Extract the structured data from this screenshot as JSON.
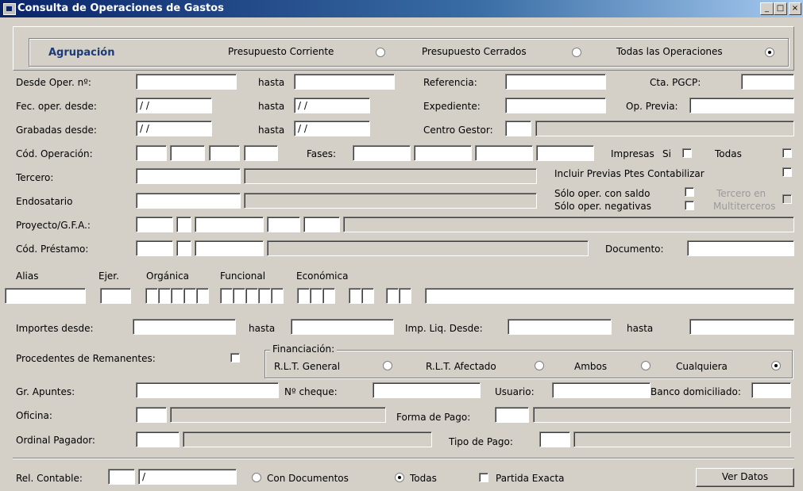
{
  "window": {
    "title": "Consulta de Operaciones de Gastos",
    "min_label": "_",
    "max_label": "□",
    "close_label": "×"
  },
  "agrupacion": {
    "label": "Agrupación",
    "options": [
      "Presupuesto Corriente",
      "Presupuesto Cerrados",
      "Todas las Operaciones"
    ],
    "selected": "Todas las Operaciones"
  },
  "labels": {
    "desde_oper": "Desde Oper. nº:",
    "hasta": "hasta",
    "referencia": "Referencia:",
    "cta_pgcp": "Cta. PGCP:",
    "fec_oper": "Fec. oper. desde:",
    "expediente": "Expediente:",
    "op_previa": "Op. Previa:",
    "grabadas": "Grabadas desde:",
    "centro_gestor": "Centro Gestor:",
    "cod_operacion": "Cód. Operación:",
    "fases": "Fases:",
    "impresas": "Impresas",
    "si": "Si",
    "todas": "Todas",
    "tercero": "Tercero:",
    "incluir_previas": "Incluir Previas Ptes Contabilizar",
    "endosatario": "Endosatario",
    "solo_saldo": "Sólo oper. con saldo",
    "solo_negativas": "Sólo oper. negativas",
    "tercero_en": "Tercero en",
    "multiterceros": "Multiterceros",
    "proyecto": "Proyecto/G.F.A.:",
    "cod_prestamo": "Cód. Préstamo:",
    "documento": "Documento:",
    "alias": "Alias",
    "ejer": "Ejer.",
    "organica": "Orgánica",
    "funcional": "Funcional",
    "economica": "Económica",
    "importes_desde": "Importes desde:",
    "imp_liq": "Imp. Liq. Desde:",
    "procedentes": "Procedentes de Remanentes:",
    "financiacion": "Financiación:",
    "gr_apuntes": "Gr. Apuntes:",
    "n_cheque": "Nº cheque:",
    "usuario": "Usuario:",
    "banco": "Banco domiciliado:",
    "oficina": "Oficina:",
    "forma_pago": "Forma de Pago:",
    "ordinal": "Ordinal Pagador:",
    "tipo_pago": "Tipo de Pago:",
    "rel_contable": "Rel. Contable:"
  },
  "values": {
    "fec_desde": "/ /",
    "fec_hasta": "/ /",
    "grab_desde": "/ /",
    "grab_hasta": "/ /",
    "rel_date": "/"
  },
  "financiacion": {
    "options": [
      "R.L.T. General",
      "R.L.T. Afectado",
      "Ambos",
      "Cualquiera"
    ],
    "selected": "Cualquiera"
  },
  "footer": {
    "con_documentos": "Con Documentos",
    "todas": "Todas",
    "partida_exacta": "Partida Exacta",
    "ver_datos": "Ver Datos",
    "selected": "Todas"
  }
}
